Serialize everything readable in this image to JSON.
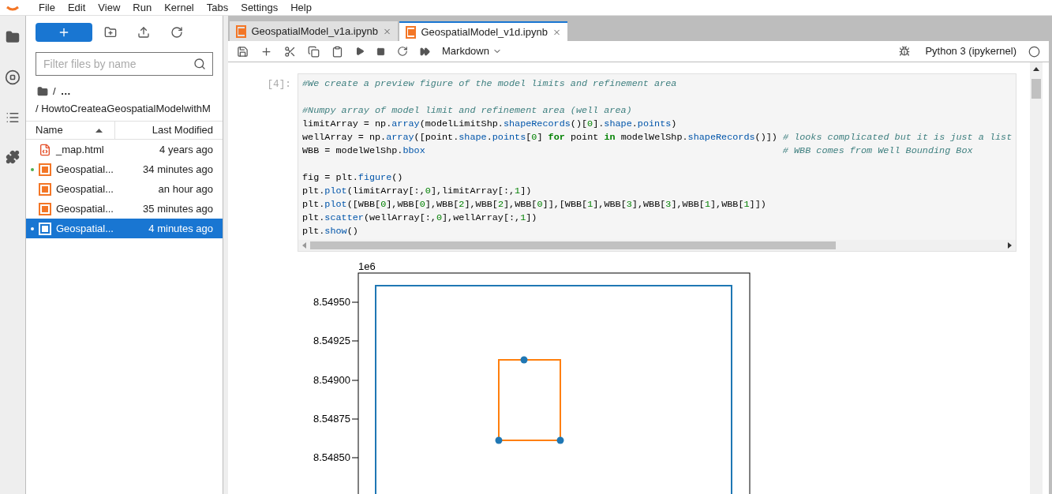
{
  "menu": [
    "File",
    "Edit",
    "View",
    "Run",
    "Kernel",
    "Tabs",
    "Settings",
    "Help"
  ],
  "file_browser": {
    "filter": {
      "placeholder": "Filter files by name"
    },
    "breadcrumb_root": "/",
    "breadcrumb_more": "…",
    "path": "/ HowtoCreateaGeospatialModelwithM",
    "columns": [
      {
        "label": "Name",
        "sorted": true
      },
      {
        "label": "Last Modified",
        "sorted": false
      }
    ],
    "files": [
      {
        "kind": "html",
        "name": "_map.html",
        "modified": "4 years ago",
        "running": false,
        "selected": false
      },
      {
        "kind": "notebook",
        "name": "Geospatial...",
        "modified": "34 minutes ago",
        "running": true,
        "selected": false
      },
      {
        "kind": "notebook",
        "name": "Geospatial...",
        "modified": "an hour ago",
        "running": false,
        "selected": false
      },
      {
        "kind": "notebook",
        "name": "Geospatial...",
        "modified": "35 minutes ago",
        "running": false,
        "selected": false
      },
      {
        "kind": "notebook",
        "name": "Geospatial...",
        "modified": "4 minutes ago",
        "running": true,
        "selected": true
      }
    ]
  },
  "tabs": [
    {
      "label": "GeospatialModel_v1a.ipynb",
      "selected": false
    },
    {
      "label": "GeospatialModel_v1d.ipynb",
      "selected": true
    }
  ],
  "toolbar": {
    "cell_type": "Markdown",
    "kernel": "Python 3 (ipykernel)"
  },
  "cell": {
    "prompt": "[4]:",
    "lines": [
      {
        "kind": "code",
        "tokens": [
          {
            "kind": "comment",
            "text": "#We create a preview figure of the model limits and refinement area"
          }
        ]
      },
      {
        "kind": "blank"
      },
      {
        "kind": "code",
        "tokens": [
          {
            "kind": "comment",
            "text": "#Numpy array of model limit and refinement area (well area)"
          }
        ]
      },
      {
        "kind": "code",
        "tokens": [
          {
            "kind": "plain",
            "text": "limitArray = np."
          },
          {
            "kind": "attr",
            "text": "array"
          },
          {
            "kind": "plain",
            "text": "(modelLimitShp."
          },
          {
            "kind": "attr",
            "text": "shapeRecords"
          },
          {
            "kind": "plain",
            "text": "()["
          },
          {
            "kind": "number",
            "text": "0"
          },
          {
            "kind": "plain",
            "text": "]."
          },
          {
            "kind": "attr",
            "text": "shape"
          },
          {
            "kind": "plain",
            "text": "."
          },
          {
            "kind": "attr",
            "text": "points"
          },
          {
            "kind": "plain",
            "text": ")"
          }
        ]
      },
      {
        "kind": "code",
        "tokens": [
          {
            "kind": "plain",
            "text": "wellArray = np."
          },
          {
            "kind": "attr",
            "text": "array"
          },
          {
            "kind": "plain",
            "text": "([point."
          },
          {
            "kind": "attr",
            "text": "shape"
          },
          {
            "kind": "plain",
            "text": "."
          },
          {
            "kind": "attr",
            "text": "points"
          },
          {
            "kind": "plain",
            "text": "["
          },
          {
            "kind": "number",
            "text": "0"
          },
          {
            "kind": "plain",
            "text": "] "
          },
          {
            "kind": "keyword",
            "text": "for"
          },
          {
            "kind": "plain",
            "text": " point "
          },
          {
            "kind": "keyword",
            "text": "in"
          },
          {
            "kind": "plain",
            "text": " modelWelShp."
          },
          {
            "kind": "attr",
            "text": "shapeRecords"
          },
          {
            "kind": "plain",
            "text": "()]) "
          },
          {
            "kind": "comment",
            "text": "# looks complicated but it is just a list"
          }
        ]
      },
      {
        "kind": "code",
        "tokens": [
          {
            "kind": "plain",
            "text": "WBB = modelWelShp."
          },
          {
            "kind": "attr",
            "text": "bbox"
          },
          {
            "kind": "comment",
            "text": "                                                                # WBB comes from Well Bounding Box"
          }
        ]
      },
      {
        "kind": "blank"
      },
      {
        "kind": "code",
        "tokens": [
          {
            "kind": "plain",
            "text": "fig = plt."
          },
          {
            "kind": "attr",
            "text": "figure"
          },
          {
            "kind": "plain",
            "text": "()"
          }
        ]
      },
      {
        "kind": "code",
        "tokens": [
          {
            "kind": "plain",
            "text": "plt."
          },
          {
            "kind": "attr",
            "text": "plot"
          },
          {
            "kind": "plain",
            "text": "(limitArray[:,"
          },
          {
            "kind": "number",
            "text": "0"
          },
          {
            "kind": "plain",
            "text": "],limitArray[:,"
          },
          {
            "kind": "number",
            "text": "1"
          },
          {
            "kind": "plain",
            "text": "])"
          }
        ]
      },
      {
        "kind": "code",
        "tokens": [
          {
            "kind": "plain",
            "text": "plt."
          },
          {
            "kind": "attr",
            "text": "plot"
          },
          {
            "kind": "plain",
            "text": "([WBB["
          },
          {
            "kind": "number",
            "text": "0"
          },
          {
            "kind": "plain",
            "text": "],WBB["
          },
          {
            "kind": "number",
            "text": "0"
          },
          {
            "kind": "plain",
            "text": "],WBB["
          },
          {
            "kind": "number",
            "text": "2"
          },
          {
            "kind": "plain",
            "text": "],WBB["
          },
          {
            "kind": "number",
            "text": "2"
          },
          {
            "kind": "plain",
            "text": "],WBB["
          },
          {
            "kind": "number",
            "text": "0"
          },
          {
            "kind": "plain",
            "text": "]],[WBB["
          },
          {
            "kind": "number",
            "text": "1"
          },
          {
            "kind": "plain",
            "text": "],WBB["
          },
          {
            "kind": "number",
            "text": "3"
          },
          {
            "kind": "plain",
            "text": "],WBB["
          },
          {
            "kind": "number",
            "text": "3"
          },
          {
            "kind": "plain",
            "text": "],WBB["
          },
          {
            "kind": "number",
            "text": "1"
          },
          {
            "kind": "plain",
            "text": "],WBB["
          },
          {
            "kind": "number",
            "text": "1"
          },
          {
            "kind": "plain",
            "text": "]])"
          }
        ]
      },
      {
        "kind": "code",
        "tokens": [
          {
            "kind": "plain",
            "text": "plt."
          },
          {
            "kind": "attr",
            "text": "scatter"
          },
          {
            "kind": "plain",
            "text": "(wellArray[:,"
          },
          {
            "kind": "number",
            "text": "0"
          },
          {
            "kind": "plain",
            "text": "],wellArray[:,"
          },
          {
            "kind": "number",
            "text": "1"
          },
          {
            "kind": "plain",
            "text": "])"
          }
        ]
      },
      {
        "kind": "code",
        "tokens": [
          {
            "kind": "plain",
            "text": "plt."
          },
          {
            "kind": "attr",
            "text": "show"
          },
          {
            "kind": "plain",
            "text": "()"
          }
        ]
      }
    ]
  },
  "plot": {
    "offset_label": "1e6",
    "ytick_labels": [
      "8.54950",
      "8.54925",
      "8.54900",
      "8.54875",
      "8.54850"
    ]
  }
}
